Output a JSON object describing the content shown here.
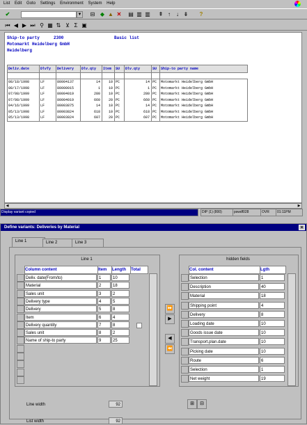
{
  "menu": [
    "List",
    "Edit",
    "Goto",
    "Settings",
    "Environment",
    "System",
    "Help"
  ],
  "report": {
    "ship_to_label": "Ship-to party",
    "ship_to_number": "2300",
    "title": "Basic list",
    "name1": "Motomarkt Heidelberg GmbH",
    "name2": "Heidelberg",
    "columns": [
      "Deliv.date",
      "DlvTy",
      "Delivery",
      "Dlv.qty",
      "Item",
      "SU",
      "Dlv.qty",
      "SU",
      "Ship-to party name"
    ],
    "rows": [
      [
        "08/18/1998",
        "LF",
        "80004137",
        "14",
        "10",
        "PC",
        "14",
        "PC",
        "Motomarkt Heidelberg GmbH"
      ],
      [
        "08/17/1998",
        "LF",
        "80000015",
        "1",
        "10",
        "PC",
        "1",
        "PC",
        "Motomarkt Heidelberg GmbH"
      ],
      [
        "07/08/1999",
        "LF",
        "80004019",
        "280",
        "10",
        "PC",
        "280",
        "PC",
        "Motomarkt Heidelberg GmbH"
      ],
      [
        "07/08/1999",
        "LF",
        "80004019",
        "660",
        "20",
        "PC",
        "660",
        "PC",
        "Motomarkt Heidelberg GmbH"
      ],
      [
        "04/16/1999",
        "LF",
        "80003875",
        "14",
        "10",
        "PC",
        "14",
        "PC",
        "Motomarkt Heidelberg GmbH"
      ],
      [
        "05/13/1998",
        "LF",
        "80003824",
        "618",
        "10",
        "PC",
        "618",
        "PC",
        "Motomarkt Heidelberg GmbH"
      ],
      [
        "05/13/1998",
        "LF",
        "80003824",
        "607",
        "20",
        "PC",
        "607",
        "PC",
        "Motomarkt Heidelberg GmbH"
      ]
    ]
  },
  "status": {
    "message": "Display variant copied",
    "system": "DIP (1) (800)",
    "server": "pswdf028",
    "mode": "OVR",
    "time": "01:11PM"
  },
  "dialog": {
    "title": "Define variants: Deliveries by Material",
    "tabs": [
      "Line 1",
      "Line 2",
      "Line 3"
    ],
    "left": {
      "title": "Line 1",
      "headers": [
        "Column content",
        "Item",
        "Length",
        "Total"
      ],
      "rows": [
        [
          "Deliv. date(From/to)",
          "1",
          "10"
        ],
        [
          "Material",
          "2",
          "18"
        ],
        [
          "Sales unit",
          "3",
          "2"
        ],
        [
          "Delivery type",
          "4",
          "5"
        ],
        [
          "Delivery",
          "5",
          "8"
        ],
        [
          "Item",
          "6",
          "4"
        ],
        [
          "Delivery quantity",
          "7",
          "8"
        ],
        [
          "Sales unit",
          "8",
          "2"
        ],
        [
          "Name of ship-to party",
          "9",
          "25"
        ]
      ]
    },
    "right": {
      "title": "hidden fields",
      "headers": [
        "Col. content",
        "Lgth"
      ],
      "rows": [
        [
          "Selection",
          "1"
        ],
        [
          "Description",
          "40"
        ],
        [
          "Material",
          "18"
        ],
        [
          "Shipping point",
          "4"
        ],
        [
          "Delivery",
          "8"
        ],
        [
          "Loading date",
          "10"
        ],
        [
          "Goods issue date",
          "10"
        ],
        [
          "Transport.plan.date",
          "10"
        ],
        [
          "Picking date",
          "10"
        ],
        [
          "Route",
          "6"
        ],
        [
          "Selection",
          "1"
        ],
        [
          "Net weight",
          "19"
        ]
      ]
    },
    "line_width_label": "Line width",
    "line_width": "92",
    "list_width_label": "List width",
    "list_width": "92"
  }
}
